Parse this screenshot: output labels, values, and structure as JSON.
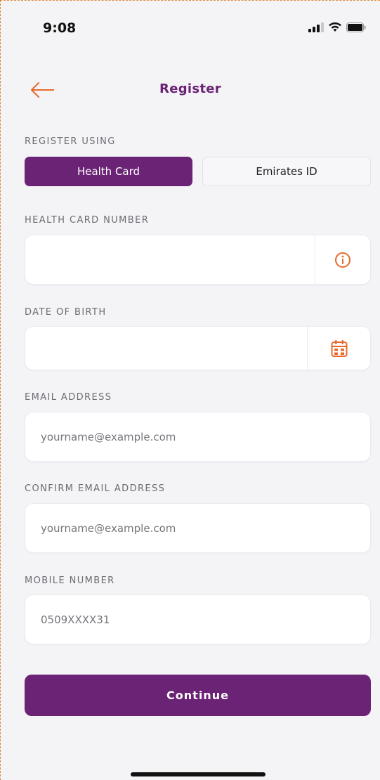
{
  "status_bar": {
    "time": "9:08"
  },
  "header": {
    "title": "Register"
  },
  "register_using": {
    "label": "REGISTER USING",
    "options": [
      "Health Card",
      "Emirates ID"
    ],
    "selected": "Health Card"
  },
  "form": {
    "health_card": {
      "label": "HEALTH CARD NUMBER",
      "value": "",
      "placeholder": ""
    },
    "dob": {
      "label": "DATE OF BIRTH",
      "value": "",
      "placeholder": ""
    },
    "email": {
      "label": "EMAIL ADDRESS",
      "value": "",
      "placeholder": "yourname@example.com"
    },
    "confirm_email": {
      "label": "CONFIRM EMAIL ADDRESS",
      "value": "",
      "placeholder": "yourname@example.com"
    },
    "mobile": {
      "label": "MOBILE NUMBER",
      "value": "",
      "placeholder": "0509XXXX31"
    }
  },
  "continue_label": "Continue",
  "colors": {
    "brand": "#6b2375",
    "accent": "#e8692a",
    "background": "#f4f3f6"
  },
  "icons": {
    "back": "arrow-left-icon",
    "info": "info-circle-icon",
    "calendar": "calendar-icon",
    "signal": "signal-icon",
    "wifi": "wifi-icon",
    "battery": "battery-icon"
  }
}
